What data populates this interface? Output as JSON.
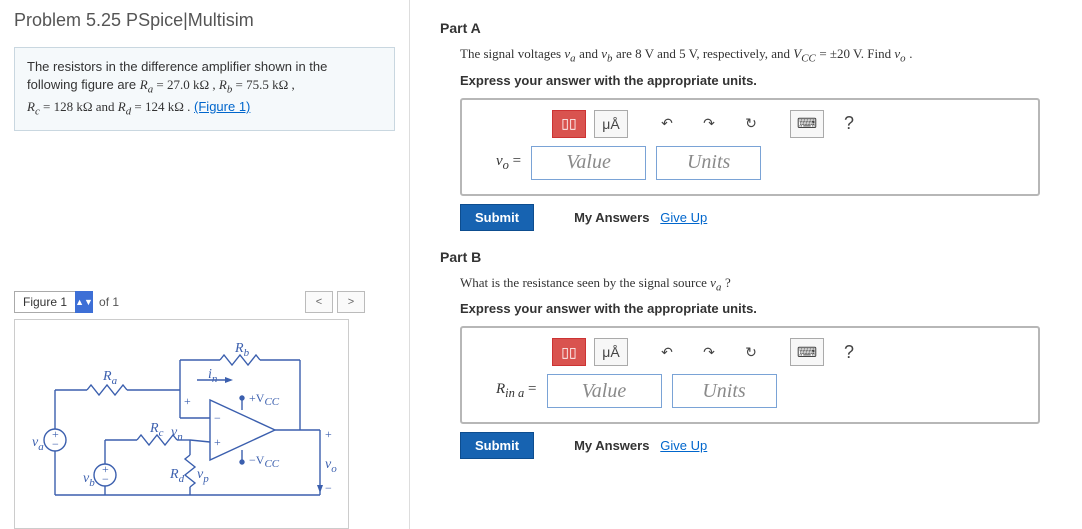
{
  "title": "Problem 5.25 PSpice|Multisim",
  "problem": {
    "line1": "The resistors in the difference amplifier shown in the",
    "line2_pre": "following figure are ",
    "Ra_var": "R",
    "Ra_sub": "a",
    "Ra_eq": " = 27.0 kΩ , ",
    "Rb_var": "R",
    "Rb_sub": "b",
    "Rb_eq": " = 75.5 kΩ ,",
    "line3_pre": "",
    "Rc_var": "R",
    "Rc_sub": "c",
    "Rc_eq": " = 128 kΩ and ",
    "Rd_var": "R",
    "Rd_sub": "d",
    "Rd_eq": " = 124 kΩ .",
    "figlink": "(Figure 1)"
  },
  "figure_ctrl": {
    "label": "Figure 1",
    "of": "of 1",
    "prev": "<",
    "next": ">"
  },
  "circuit": {
    "Ra": "R",
    "Ra_s": "a",
    "Rb": "R",
    "Rb_s": "b",
    "Rc": "R",
    "Rc_s": "c",
    "Rd": "R",
    "Rd_s": "d",
    "in": "i",
    "in_s": "n",
    "va": "v",
    "va_s": "a",
    "vb": "v",
    "vb_s": "b",
    "vn": "v",
    "vn_s": "n",
    "vp": "v",
    "vp_s": "p",
    "vo": "v",
    "vo_s": "o",
    "pvcc": "+V",
    "pvcc_s": "CC",
    "nvcc": "−V",
    "nvcc_s": "CC",
    "plus": "+",
    "minus": "−"
  },
  "partA": {
    "label": "Part A",
    "prompt_pre": "The signal voltages ",
    "va": "v",
    "va_s": "a",
    "and": " and ",
    "vb": "v",
    "vb_s": "b",
    "mid": " are 8 V and 5 V, respectively, and ",
    "vcc": "V",
    "vcc_s": "CC",
    "vcc_eq": " = ±20 V. Find ",
    "vo": "v",
    "vo_s": "o",
    "end": " .",
    "hint": "Express your answer with the appropriate units.",
    "lhs": "v",
    "lhs_s": "o",
    "eq": " =",
    "val_ph": "Value",
    "unit_ph": "Units"
  },
  "partB": {
    "label": "Part B",
    "prompt_pre": "What is the resistance seen by the signal source ",
    "va": "v",
    "va_s": "a",
    "end": " ?",
    "hint": "Express your answer with the appropriate units.",
    "lhs": "R",
    "lhs_s": "in a",
    "eq": " =",
    "val_ph": "Value",
    "unit_ph": "Units"
  },
  "toolbar": {
    "t1": "▯▯",
    "t2": "μÅ",
    "undo": "↶",
    "redo": "↷",
    "reset": "↻",
    "kbd": "⌨",
    "help": "?"
  },
  "actions": {
    "submit": "Submit",
    "mya": "My Answers",
    "giveup": "Give Up"
  }
}
